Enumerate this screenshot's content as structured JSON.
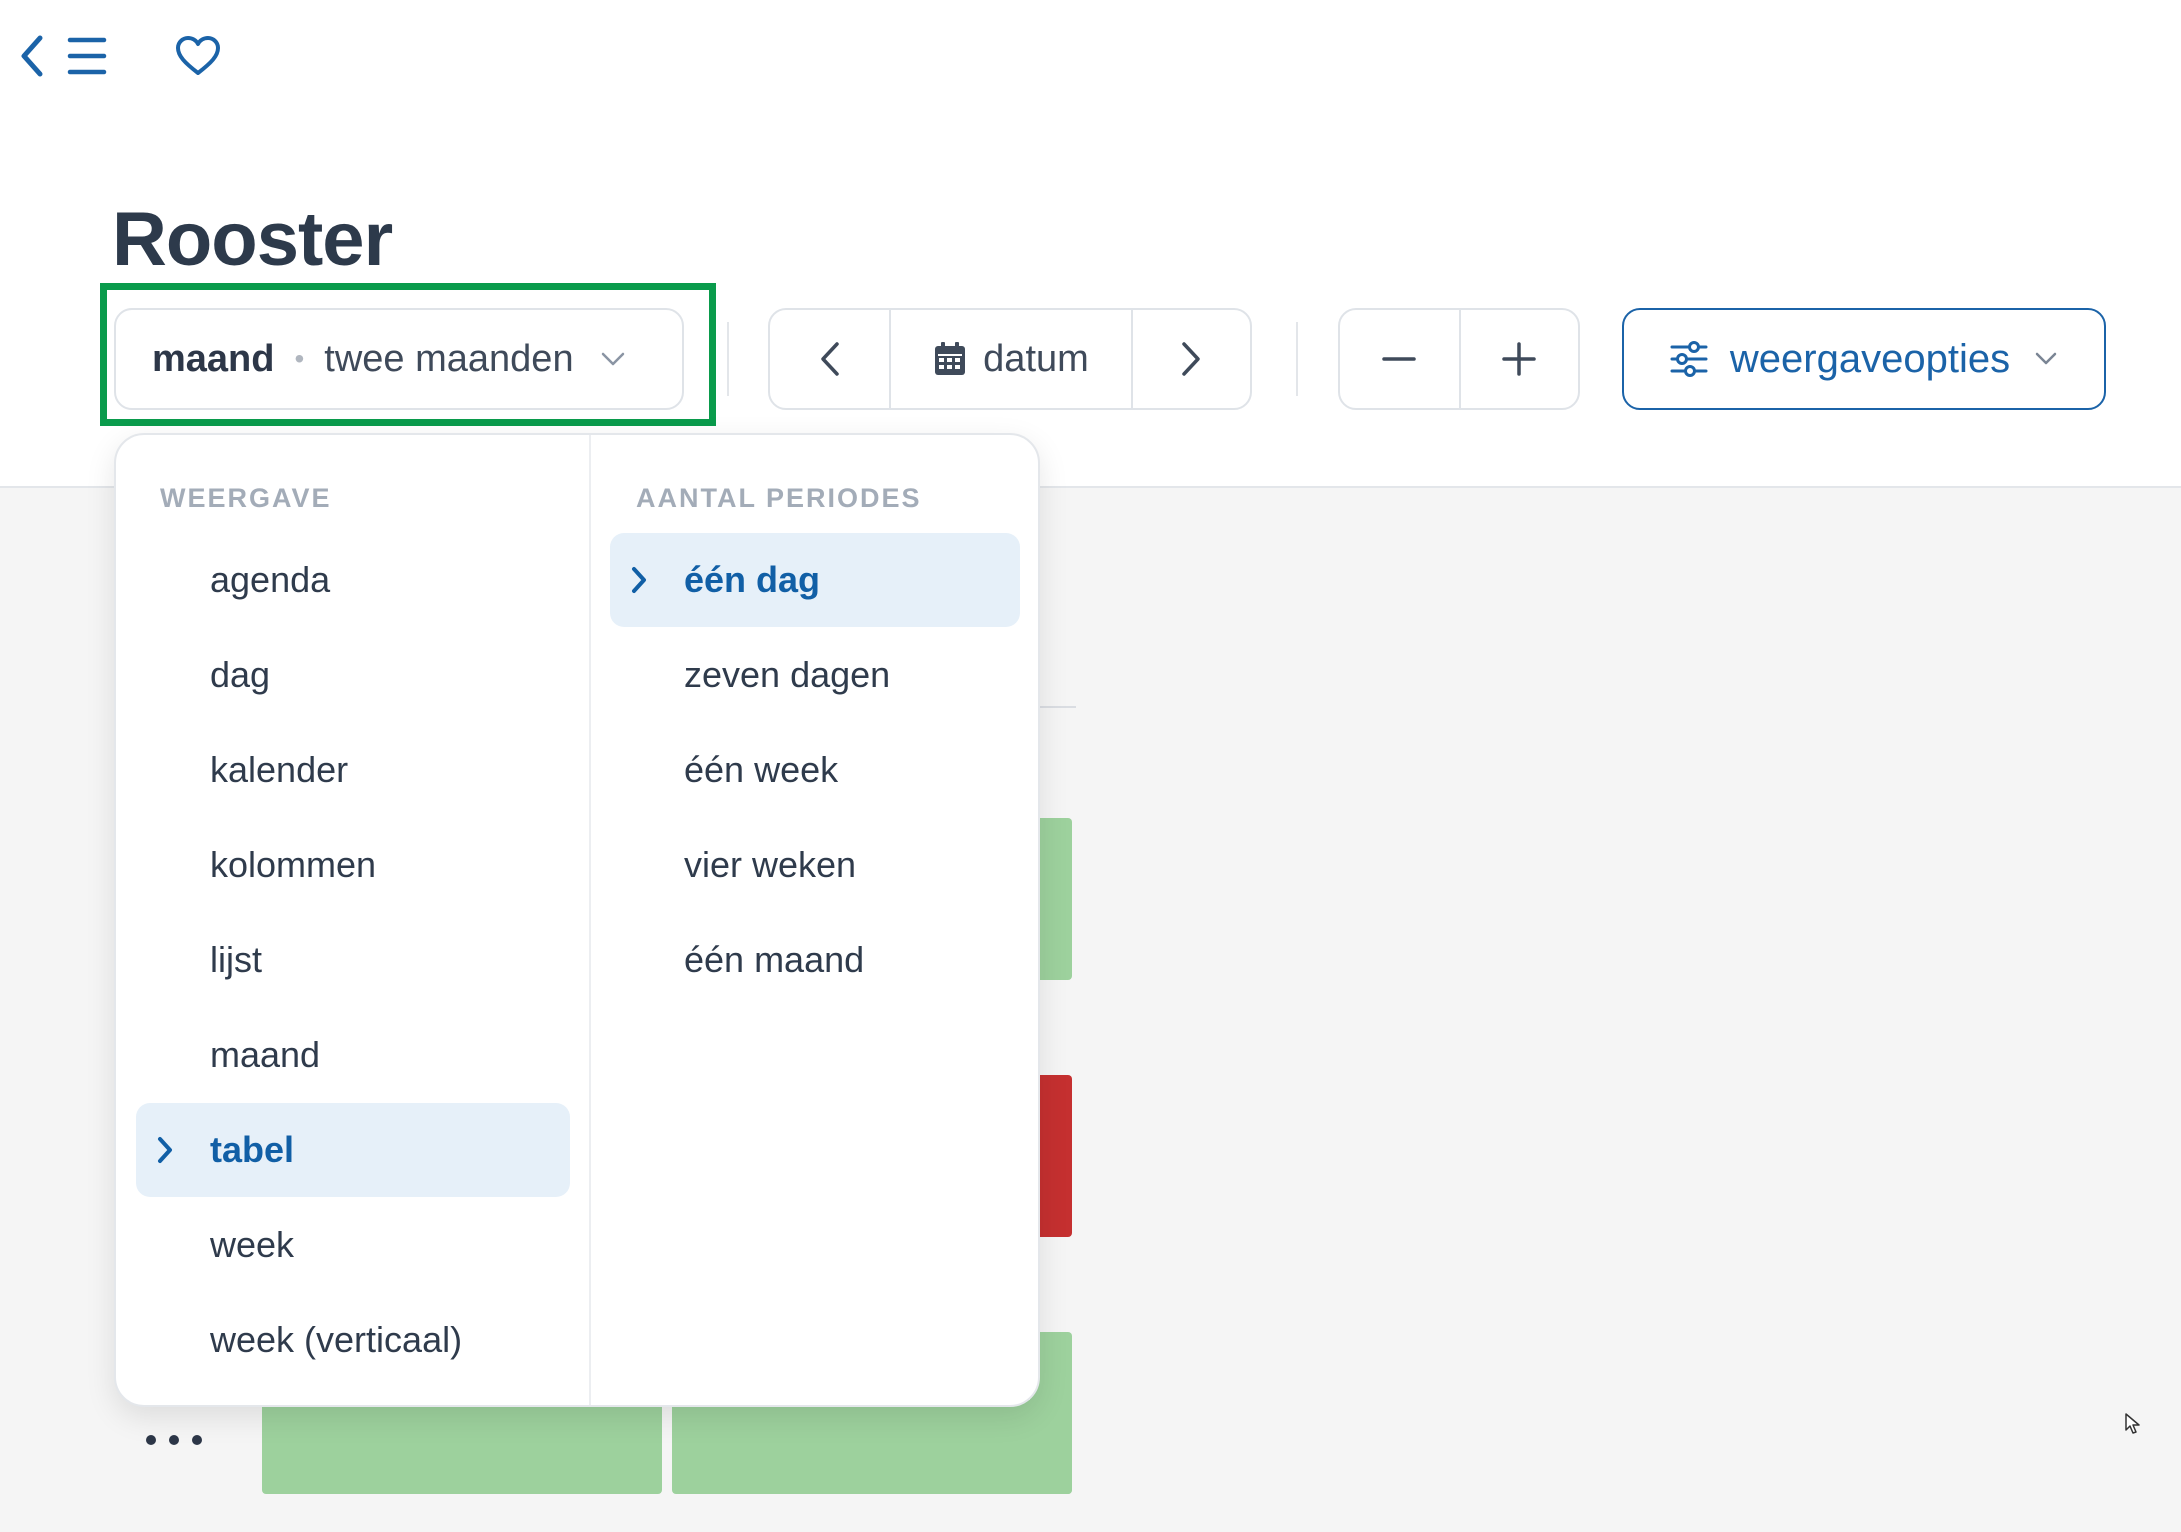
{
  "header": {
    "back_icon": "chevron-left-icon",
    "menu_icon": "hamburger-menu-icon",
    "favorite_icon": "heart-icon",
    "title": "Rooster"
  },
  "toolbar": {
    "view_selector": {
      "view": "maand",
      "periods": "twee maanden"
    },
    "date_nav": {
      "label": "datum"
    },
    "options_label": "weergaveopties"
  },
  "dropdown": {
    "view_header": "WEERGAVE",
    "views": [
      {
        "label": "agenda",
        "selected": false
      },
      {
        "label": "dag",
        "selected": false
      },
      {
        "label": "kalender",
        "selected": false
      },
      {
        "label": "kolommen",
        "selected": false
      },
      {
        "label": "lijst",
        "selected": false
      },
      {
        "label": "maand",
        "selected": false
      },
      {
        "label": "tabel",
        "selected": true
      },
      {
        "label": "week",
        "selected": false
      },
      {
        "label": "week (verticaal)",
        "selected": false
      }
    ],
    "periods_header": "AANTAL PERIODES",
    "periods": [
      {
        "label": "één dag",
        "selected": true
      },
      {
        "label": "zeven dagen",
        "selected": false
      },
      {
        "label": "één week",
        "selected": false
      },
      {
        "label": "vier weken",
        "selected": false
      },
      {
        "label": "één maand",
        "selected": false
      }
    ]
  },
  "colors": {
    "accent": "#1b63a8",
    "highlight_frame": "#0a9b4c",
    "event_green": "#9dd19d",
    "event_red": "#c53030"
  }
}
